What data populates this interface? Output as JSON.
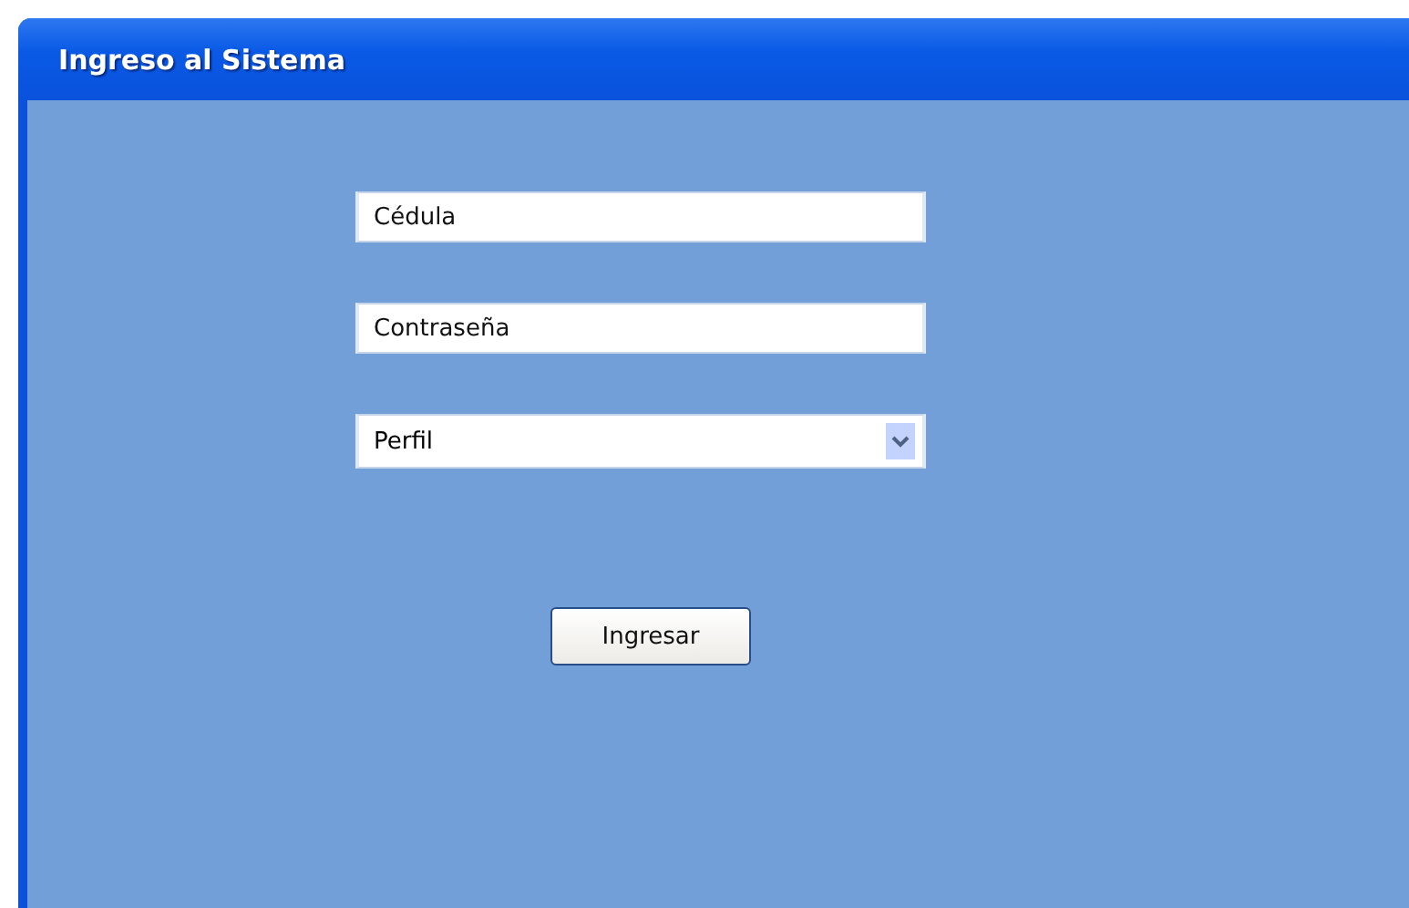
{
  "window": {
    "title": "Ingreso al Sistema"
  },
  "fields": [
    {
      "kind": "text",
      "placeholder": "Cédula"
    },
    {
      "kind": "text",
      "placeholder": "Contraseña"
    },
    {
      "kind": "select",
      "value": "Perfil"
    }
  ],
  "button": "Ingresar"
}
